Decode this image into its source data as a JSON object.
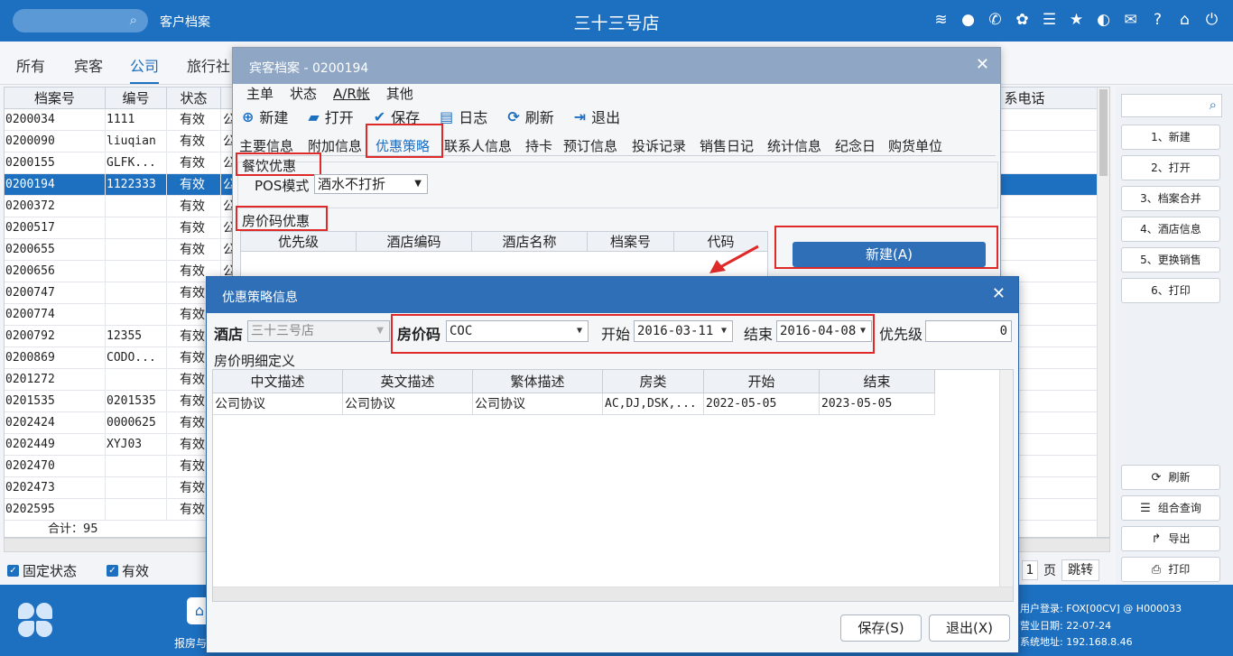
{
  "topbar": {
    "module": "客户档案",
    "title": "三十三号店",
    "icons": [
      "wifi-icon",
      "chat-icon",
      "phone-icon",
      "palette-icon",
      "menu-icon",
      "star-icon",
      "contrast-icon",
      "mail-icon",
      "help-icon",
      "home-icon",
      "power-icon"
    ]
  },
  "category_tabs": [
    "所有",
    "宾客",
    "公司",
    "旅行社"
  ],
  "grid": {
    "headers": [
      "档案号",
      "编号",
      "状态",
      "系电话"
    ],
    "rows": [
      {
        "id": "0200034",
        "code": "1111",
        "status": "有效",
        "t": "公"
      },
      {
        "id": "0200090",
        "code": "liuqian",
        "status": "有效",
        "t": "公"
      },
      {
        "id": "0200155",
        "code": "GLFK...",
        "status": "有效",
        "t": "公"
      },
      {
        "id": "0200194",
        "code": "1122333",
        "status": "有效",
        "t": "公"
      },
      {
        "id": "0200372",
        "code": "",
        "status": "有效",
        "t": "公"
      },
      {
        "id": "0200517",
        "code": "",
        "status": "有效",
        "t": "公"
      },
      {
        "id": "0200655",
        "code": "",
        "status": "有效",
        "t": "公"
      },
      {
        "id": "0200656",
        "code": "",
        "status": "有效",
        "t": "公"
      },
      {
        "id": "0200747",
        "code": "",
        "status": "有效",
        "t": ""
      },
      {
        "id": "0200774",
        "code": "",
        "status": "有效",
        "t": ""
      },
      {
        "id": "0200792",
        "code": "12355",
        "status": "有效",
        "t": ""
      },
      {
        "id": "0200869",
        "code": "CODO...",
        "status": "有效",
        "t": ""
      },
      {
        "id": "0201272",
        "code": "",
        "status": "有效",
        "t": ""
      },
      {
        "id": "0201535",
        "code": "0201535",
        "status": "有效",
        "t": ""
      },
      {
        "id": "0202424",
        "code": "0000625",
        "status": "有效",
        "t": ""
      },
      {
        "id": "0202449",
        "code": "XYJ03",
        "status": "有效",
        "t": ""
      },
      {
        "id": "0202470",
        "code": "",
        "status": "有效",
        "t": ""
      },
      {
        "id": "0202473",
        "code": "",
        "status": "有效",
        "t": ""
      },
      {
        "id": "0202595",
        "code": "",
        "status": "有效",
        "t": ""
      }
    ],
    "selected_row": 3,
    "total": "合计：95"
  },
  "checkbar": {
    "fixed_status": "固定状态",
    "valid": "有效",
    "page": "1",
    "page_unit": "页",
    "jump": "跳转"
  },
  "right_panel": {
    "buttons": [
      "1、新建",
      "2、打开",
      "3、档案合并",
      "4、酒店信息",
      "5、更换销售",
      "6、打印"
    ],
    "bottom_buttons": [
      {
        "label": "刷新",
        "icon": "refresh-icon"
      },
      {
        "label": "组合查询",
        "icon": "list-icon"
      },
      {
        "label": "导出",
        "icon": "export-icon"
      },
      {
        "label": "打印",
        "icon": "print-icon"
      }
    ]
  },
  "bottombar": {
    "home_label": "报房与",
    "user_login": "用户登录:  FOX[00CV] @ H000033",
    "business_date": "营业日期:  22-07-24",
    "system_address": "系统地址:  192.168.8.46"
  },
  "profile_dialog": {
    "title": "宾客档案 - 0200194",
    "menu": [
      "主单",
      "状态",
      "A/R帐",
      "其他"
    ],
    "toolbar": [
      {
        "label": "新建",
        "icon": "plus-icon"
      },
      {
        "label": "打开",
        "icon": "folder-icon"
      },
      {
        "label": "保存",
        "icon": "check-icon"
      },
      {
        "label": "日志",
        "icon": "log-icon"
      },
      {
        "label": "刷新",
        "icon": "refresh-icon"
      },
      {
        "label": "退出",
        "icon": "exit-icon"
      }
    ],
    "tabs": [
      "主要信息",
      "附加信息",
      "优惠策略",
      "联系人信息",
      "持卡",
      "预订信息",
      "投诉记录",
      "销售日记",
      "统计信息",
      "纪念日",
      "购货单位"
    ],
    "active_tab": "优惠策略",
    "fnb_section": "餐饮优惠",
    "pos_mode_label": "POS模式",
    "pos_mode_value": "酒水不打折",
    "room_section": "房价码优惠",
    "room_grid_headers": [
      "优先级",
      "酒店编码",
      "酒店名称",
      "档案号",
      "代码"
    ],
    "new_button": "新建(A)"
  },
  "discount_dialog": {
    "title": "优惠策略信息",
    "hotel_label": "酒店",
    "hotel_value": "三十三号店",
    "rate_code_label": "房价码",
    "rate_code_value": "COC",
    "start_label": "开始",
    "start_value": "2016-03-11",
    "end_label": "结束",
    "end_value": "2016-04-08",
    "priority_label": "优先级",
    "priority_value": "0",
    "detail_title": "房价明细定义",
    "detail_headers": [
      "中文描述",
      "英文描述",
      "繁体描述",
      "房类",
      "开始",
      "结束"
    ],
    "detail_rows": [
      [
        "公司协议",
        "公司协议",
        "公司协议",
        "AC,DJ,DSK,...",
        "2022-05-05",
        "2023-05-05"
      ]
    ],
    "save_button": "保存(S)",
    "exit_button": "退出(X)"
  }
}
